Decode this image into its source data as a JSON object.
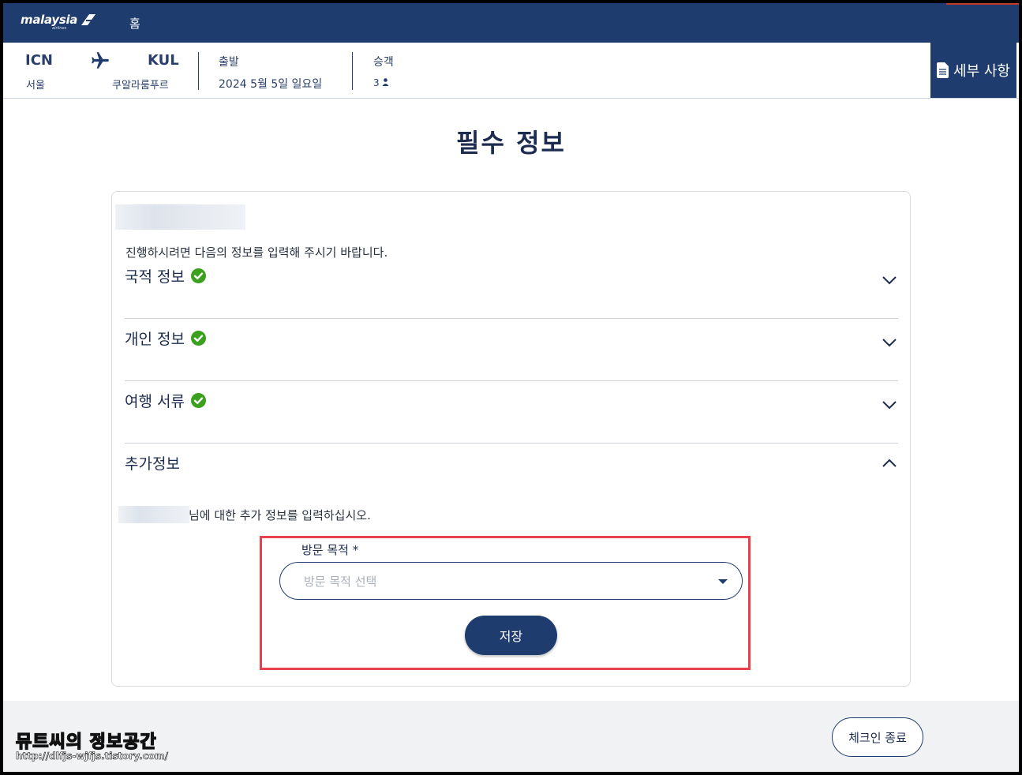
{
  "nav": {
    "logo_text": "malaysia",
    "logo_sub": "airlines",
    "home": "홈"
  },
  "flight": {
    "origin_code": "ICN",
    "origin_city": "서울",
    "dest_code": "KUL",
    "dest_city": "쿠알라룸푸르",
    "departure_label": "출발",
    "departure_date": "2024 5월 5일 일요일",
    "passengers_label": "승객",
    "passengers_count": "3"
  },
  "details_button": "세부 사항",
  "page_title": "필수 정보",
  "card": {
    "instruction": "진행하시려면 다음의 정보를 입력해 주시기 바랍니다.",
    "sections": [
      {
        "title": "국적 정보",
        "complete": true
      },
      {
        "title": "개인 정보",
        "complete": true
      },
      {
        "title": "여행 서류",
        "complete": true
      },
      {
        "title": "추가정보",
        "complete": false
      }
    ],
    "additional_subtext": "님에 대한 추가 정보를 입력하십시오.",
    "purpose_label": "방문 목적 *",
    "purpose_placeholder": "방문 목적 선택",
    "save_button": "저장"
  },
  "footer": {
    "watermark_title": "뮤트씨의 정보공간",
    "watermark_url": "http://dlfjs-wjfjs.tistory.com/",
    "exit_button": "체크인 종료"
  },
  "colors": {
    "brand_navy": "#1f3c6e",
    "check_green": "#3aa01e",
    "highlight_red": "#e8414a"
  }
}
